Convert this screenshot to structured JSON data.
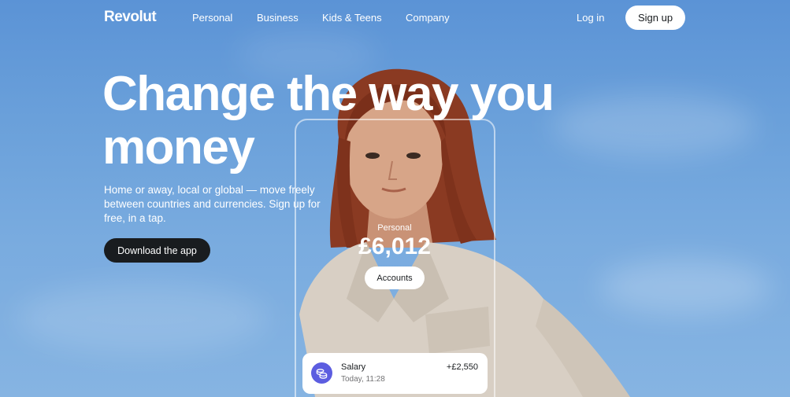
{
  "nav": {
    "logo": "Revolut",
    "links": [
      "Personal",
      "Business",
      "Kids & Teens",
      "Company"
    ],
    "login": "Log in",
    "signup": "Sign up"
  },
  "hero": {
    "headline_line1": "Change the way you",
    "headline_line2": "money",
    "subtext": "Home or away, local or global — move freely between countries and currencies. Sign up for free, in a tap.",
    "download": "Download the app"
  },
  "phone": {
    "account_label": "Personal",
    "balance": "£6,012",
    "accounts_button": "Accounts",
    "transaction": {
      "title": "Salary",
      "date": "Today, 11:28",
      "amount": "+£2,550",
      "icon": "coins-icon"
    }
  },
  "colors": {
    "sky": "#6aa0da",
    "dark_button": "#191c1f",
    "tx_icon": "#5c5de0"
  }
}
